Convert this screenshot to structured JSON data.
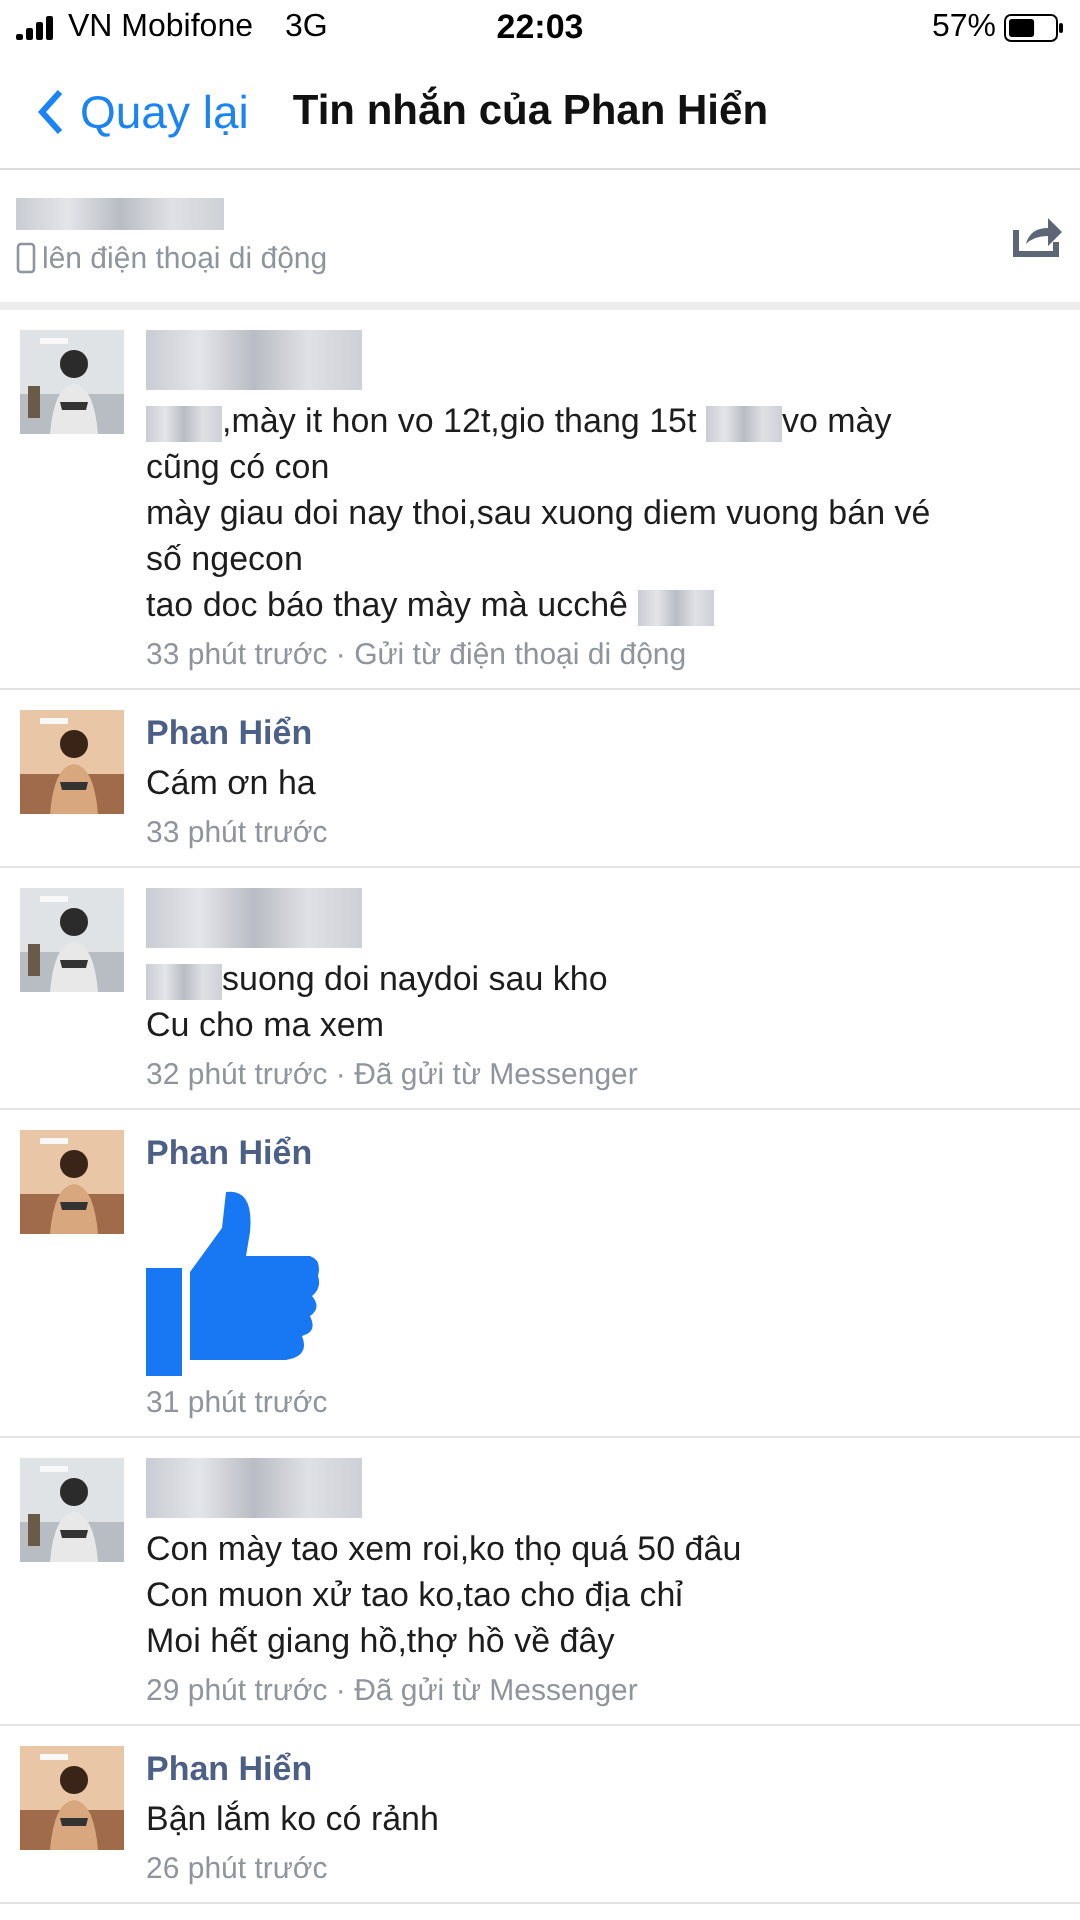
{
  "status_bar": {
    "carrier": "VN Mobifone",
    "network": "3G",
    "time": "22:03",
    "battery": "57%"
  },
  "nav": {
    "back": "Quay lại",
    "title": "Tin nhắn của Phan Hiển"
  },
  "header": {
    "name_redacted": true,
    "subtitle": "lên điện thoại di động"
  },
  "messages": [
    {
      "author_redacted": true,
      "kind": "text",
      "lines": [
        [
          {
            "kind": "redacted"
          },
          {
            "kind": "text",
            "text": ",mày it hon vo 12t,gio thang 15t "
          },
          {
            "kind": "redacted"
          },
          {
            "kind": "text",
            "text": "vo mày"
          }
        ],
        [
          {
            "kind": "text",
            "text": "cũng có con"
          }
        ],
        [
          {
            "kind": "text",
            "text": "mày giau doi nay thoi,sau xuong diem vuong bán vé"
          }
        ],
        [
          {
            "kind": "text",
            "text": "số ngecon"
          }
        ],
        [
          {
            "kind": "text",
            "text": "tao doc báo thay mày mà ucchê "
          },
          {
            "kind": "redacted"
          }
        ]
      ],
      "meta": "33 phút trước · Gửi từ điện thoại di động"
    },
    {
      "author": "Phan Hiển",
      "kind": "text",
      "lines": [
        [
          {
            "kind": "text",
            "text": "Cám ơn ha"
          }
        ]
      ],
      "meta": "33 phút trước"
    },
    {
      "author_redacted": true,
      "kind": "text",
      "lines": [
        [
          {
            "kind": "redacted"
          },
          {
            "kind": "text",
            "text": "suong doi naydoi sau kho"
          }
        ],
        [
          {
            "kind": "text",
            "text": "Cu cho ma xem"
          }
        ]
      ],
      "meta": "32 phút trước · Đã gửi từ Messenger"
    },
    {
      "author": "Phan Hiển",
      "kind": "like",
      "meta": "31 phút trước"
    },
    {
      "author_redacted": true,
      "kind": "text",
      "lines": [
        [
          {
            "kind": "text",
            "text": "Con mày tao xem roi,ko thọ quá 50 đâu"
          }
        ],
        [
          {
            "kind": "text",
            "text": "Con muon xử tao ko,tao cho địa chỉ"
          }
        ],
        [
          {
            "kind": "text",
            "text": "Moi hết giang hồ,thợ hồ về đây"
          }
        ]
      ],
      "meta": "29 phút trước · Đã gửi từ Messenger"
    },
    {
      "author": "Phan Hiển",
      "kind": "text",
      "lines": [
        [
          {
            "kind": "text",
            "text": "Bận lắm ko có rảnh"
          }
        ]
      ],
      "meta": "26 phút trước"
    }
  ]
}
